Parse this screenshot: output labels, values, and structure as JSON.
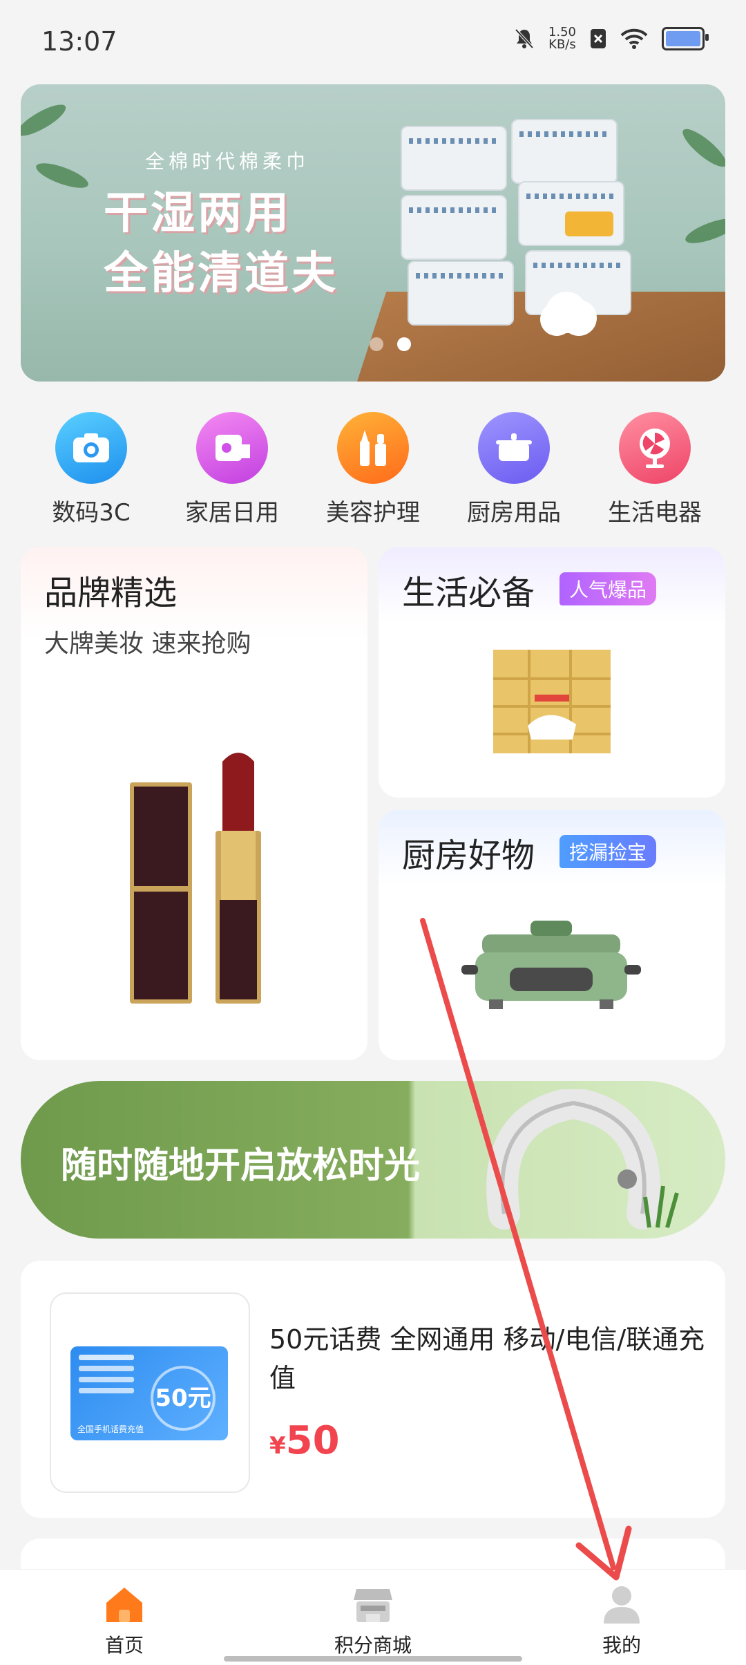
{
  "status_bar": {
    "time": "13:07",
    "speed_value": "1.50",
    "speed_unit": "KB/s"
  },
  "banner": {
    "line1": "全棉时代棉柔巾",
    "line2": "干湿两用",
    "line3": "全能清道夫",
    "dots": 2,
    "active_dot": 1
  },
  "categories": [
    {
      "label": "数码3C",
      "icon": "camera-icon"
    },
    {
      "label": "家居日用",
      "icon": "paper-roll-icon"
    },
    {
      "label": "美容护理",
      "icon": "beauty-icon"
    },
    {
      "label": "厨房用品",
      "icon": "pot-icon"
    },
    {
      "label": "生活电器",
      "icon": "fan-icon"
    }
  ],
  "cards": {
    "brand": {
      "title": "品牌精选",
      "subtitle": "大牌美妆 速来抢购"
    },
    "life": {
      "title": "生活必备",
      "badge": "人气爆品"
    },
    "kitchen": {
      "title": "厨房好物",
      "badge": "挖漏捡宝"
    }
  },
  "promo": {
    "text": "随时随地开启放松时光"
  },
  "product": {
    "name": "50元话费 全网通用 移动/电信/联通充值",
    "currency": "¥",
    "price": "50",
    "card_face": "50元",
    "card_caption": "全国手机话费充值"
  },
  "tabbar": {
    "home": "首页",
    "mall": "积分商城",
    "mine": "我的"
  },
  "colors": {
    "accent": "#ff7a1a",
    "price": "#f2444f",
    "annotation_arrow": "#ec4b4b"
  }
}
